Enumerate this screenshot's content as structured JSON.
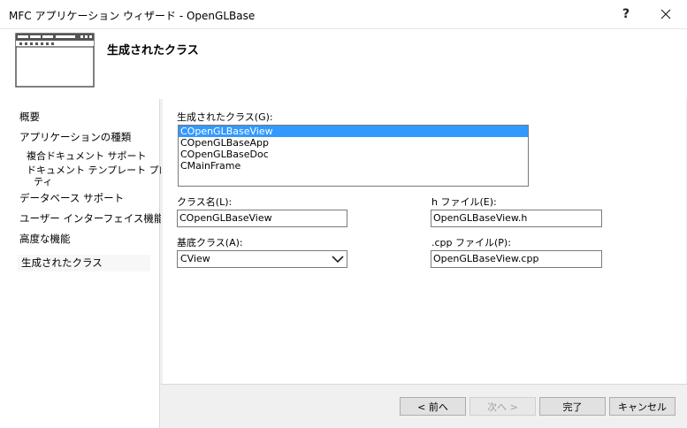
{
  "window": {
    "title": "MFC アプリケーション ウィザード - OpenGLBase",
    "help_label": "?",
    "close_label": "✕"
  },
  "header": {
    "heading": "生成されたクラス"
  },
  "sidebar": {
    "items": [
      {
        "label": "概要"
      },
      {
        "label": "アプリケーションの種類"
      },
      {
        "label": "複合ドキュメント サポート"
      },
      {
        "label": "ドキュメント テンプレート プロパ"
      },
      {
        "label": "ティ"
      },
      {
        "label": "データベース サポート"
      },
      {
        "label": "ユーザー インターフェイス機能"
      },
      {
        "label": "高度な機能"
      },
      {
        "label": "生成されたクラス"
      }
    ]
  },
  "form": {
    "generated_classes_label": "生成されたクラス(G):",
    "classes": [
      {
        "name": "COpenGLBaseView",
        "selected": true
      },
      {
        "name": "COpenGLBaseApp",
        "selected": false
      },
      {
        "name": "COpenGLBaseDoc",
        "selected": false
      },
      {
        "name": "CMainFrame",
        "selected": false
      }
    ],
    "class_name_label": "クラス名(L):",
    "class_name_value": "COpenGLBaseView",
    "h_file_label": "h ファイル(E):",
    "h_file_value": "OpenGLBaseView.h",
    "base_class_label": "基底クラス(A):",
    "base_class_value": "CView",
    "cpp_file_label": ".cpp ファイル(P):",
    "cpp_file_value": "OpenGLBaseView.cpp"
  },
  "buttons": {
    "prev": "< 前へ",
    "next": "次へ >",
    "finish": "完了",
    "cancel": "キャンセル"
  },
  "colors": {
    "selection": "#3399ff",
    "border": "#7a7a7a"
  }
}
